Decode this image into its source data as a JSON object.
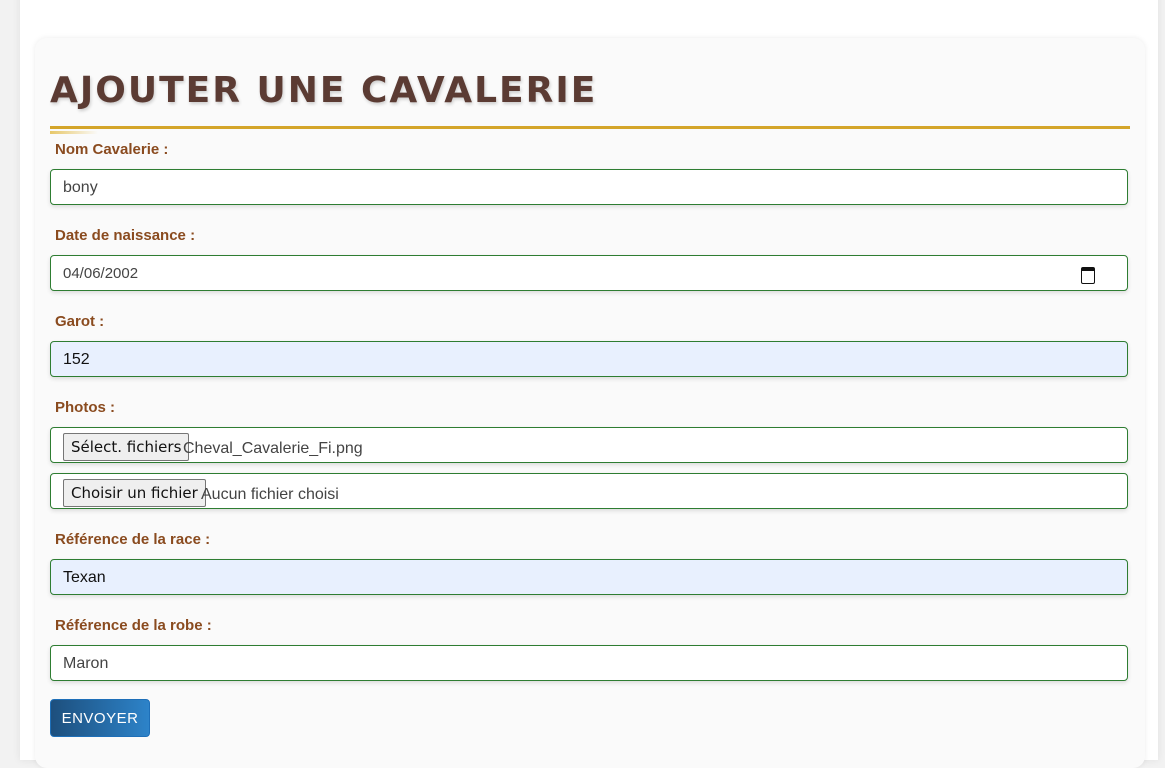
{
  "form": {
    "title": "AJOUTER UNE CAVALERIE",
    "fields": {
      "nom": {
        "label": "Nom Cavalerie :",
        "value": "bony"
      },
      "date": {
        "label": "Date de naissance :",
        "value": "04/06/2002",
        "icon": "calendar-icon"
      },
      "garot": {
        "label": "Garot :",
        "value": "152"
      },
      "photos": {
        "label": "Photos :",
        "file1": {
          "button": "Sélect. fichiers",
          "filename": "Cheval_Cavalerie_Fi.png"
        },
        "file2": {
          "button": "Choisir un fichier",
          "filename": "Aucun fichier choisi"
        }
      },
      "race": {
        "label": "Référence de la race :",
        "value": "Texan"
      },
      "robe": {
        "label": "Référence de la robe :",
        "value": "Maron"
      }
    },
    "submit_label": "ENVOYER"
  },
  "colors": {
    "title": "#5b3b33",
    "title_rule": "#d4a52a",
    "label": "#8a4b1f",
    "field_border": "#2e7d32",
    "autofill_bg": "#e8f0fe",
    "button_start": "#1d4f7d",
    "button_end": "#2d83c9"
  }
}
